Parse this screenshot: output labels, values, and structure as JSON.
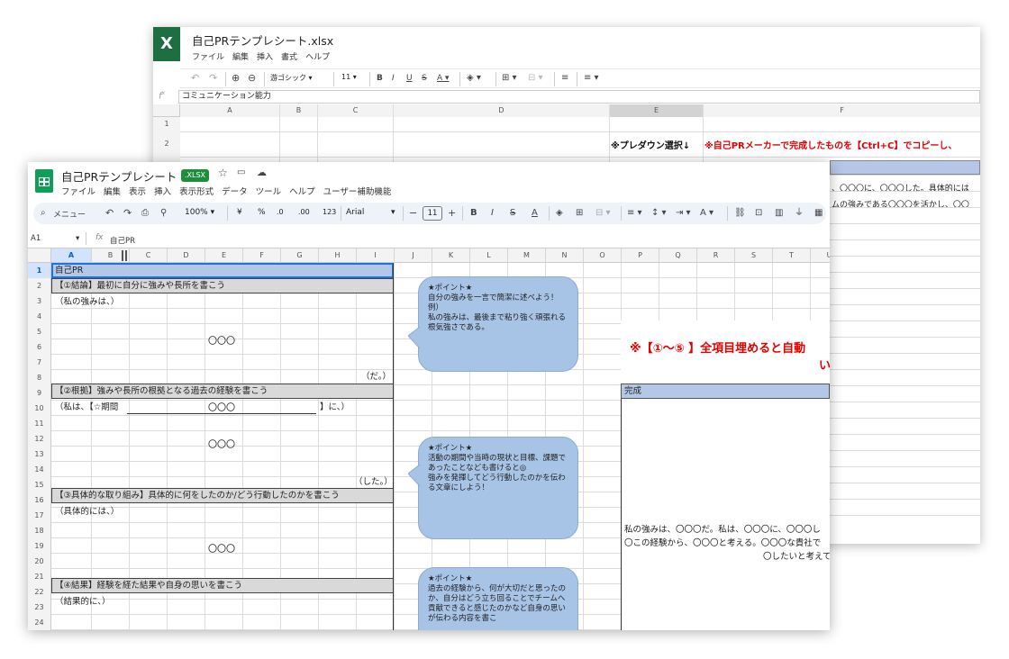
{
  "excel": {
    "title": "自己PRテンプレシート.xlsx",
    "logo_letter": "X",
    "menus": [
      "ファイル",
      "編集",
      "挿入",
      "書式",
      "ヘルプ"
    ],
    "toolbar": {
      "font": "游ゴシック",
      "size": "11"
    },
    "formula": "コミュニケーション能力",
    "columns": [
      "A",
      "B",
      "C",
      "D",
      "E",
      "F"
    ],
    "rows": [
      "1",
      "2"
    ],
    "e2": "※プレダウン選択↓",
    "f2": "※自己PRメーカーで完成したものを【Ctrl+C】でコピーし、",
    "row4_text": "、〇〇〇に、〇〇〇した。具体的には",
    "row5_text": "ムの強みである〇〇〇を活かし、〇〇"
  },
  "sheets": {
    "title": "自己PRテンプレシート",
    "badge": ".XLSX",
    "menus": [
      "ファイル",
      "編集",
      "表示",
      "挿入",
      "表示形式",
      "データ",
      "ツール",
      "ヘルプ",
      "ユーザー補助機能"
    ],
    "toolbar": {
      "search": "メニュー",
      "zoom": "100%",
      "currency": "¥",
      "percent": "%",
      "dec_less": ".0",
      "dec_more": ".00",
      "number_fmt": "123",
      "font": "Arial",
      "font_size": "11"
    },
    "cell_ref": "A1",
    "formula": "自己PR",
    "columns": [
      "A",
      "B",
      "C",
      "D",
      "E",
      "F",
      "G",
      "H",
      "I",
      "J",
      "K",
      "L",
      "M",
      "N",
      "O",
      "P",
      "Q",
      "R",
      "S",
      "T",
      "U"
    ],
    "rows": [
      "1",
      "2",
      "3",
      "4",
      "5",
      "6",
      "7",
      "8",
      "9",
      "10",
      "11",
      "12",
      "13",
      "14",
      "15",
      "16",
      "17",
      "18",
      "19",
      "20",
      "21",
      "22",
      "23",
      "24"
    ],
    "cells": {
      "r1": "自己PR",
      "r2": "【①結論】最初に自分に強みや長所を書こう",
      "r3": "（私の強みは、）",
      "r6": "〇〇〇",
      "r8": "（だ。）",
      "r9": "【②根拠】強みや長所の根拠となる過去の経験を書こう",
      "r10a": "（私は、【☆期間",
      "r10b": "〇〇〇",
      "r10c": "】に、）",
      "r13": "〇〇〇",
      "r15": "（した。）",
      "r16": "【③具体的な取り組み】具体的に何をしたのか/どう行動したのかを書こう",
      "r17": "（具体的には、）",
      "r20": "〇〇〇",
      "r22": "【④結果】経験を経た結果や自身の思いを書こう",
      "r23": "（結果的に、）"
    },
    "bubbles": [
      "★ポイント★\n自分の強みを一言で簡潔に述べよう！例）\n私の強みは、最後まで粘り強く頑張れる根気強さである。",
      "★ポイント★\n活動の期間や当時の現状と目標、課題であったことなども書けると◎\n強みを発揮してどう行動したのかを伝わる文章にしよう！",
      "★ポイント★\n過去の経験から、何が大切だと思ったのか、自分はどう立ち回ることでチームへ貢献できると感じたのかなど自身の思いが伝わる内容を書こ"
    ],
    "notice": "※【①〜⑤ 】全項目埋めると自動",
    "notice2": "い",
    "kansei": "完成",
    "output": [
      "私の強みは、〇〇〇だ。私は、〇〇〇に、〇〇〇し",
      "〇この経験から、〇〇〇と考える。〇〇〇な貴社で",
      "〇したいと考えて"
    ]
  },
  "colors": {
    "excel_green": "#1d6f42",
    "sheets_green": "#0f9d58",
    "section_gray": "#d9d9d9",
    "bubble_blue": "#a7c3e6",
    "header_blue": "#b4c7e7",
    "notice_red": "#e00000"
  }
}
